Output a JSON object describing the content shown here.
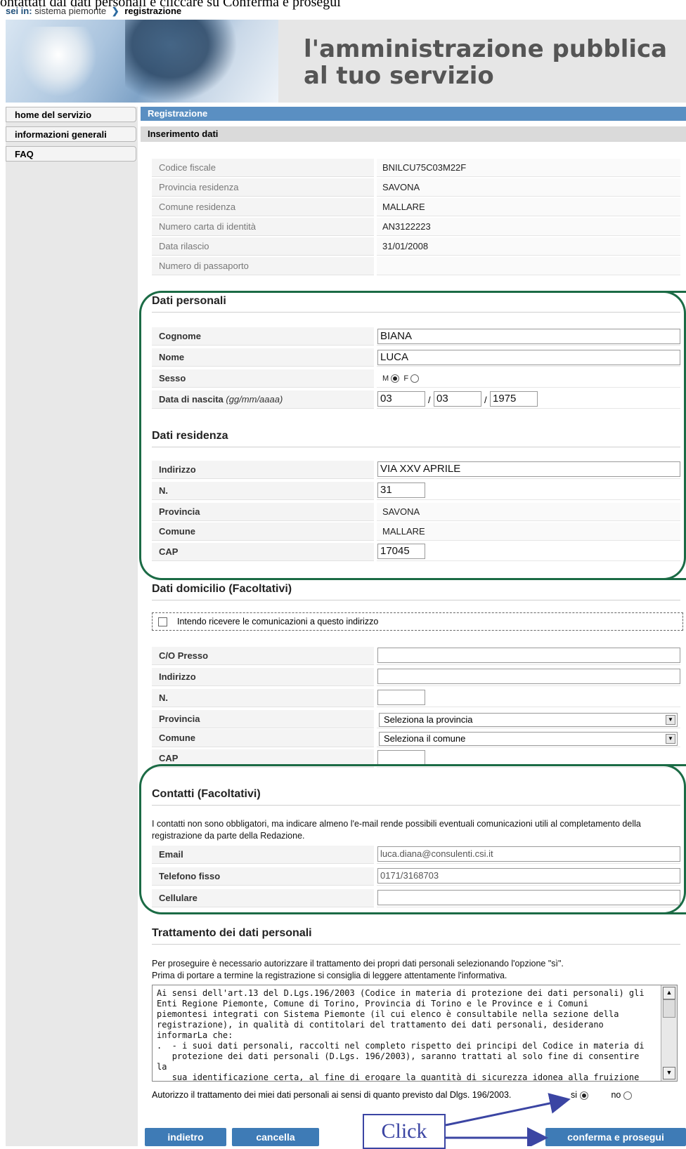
{
  "caption_text": "ontattati dai dati personali e cliccare su Conferma e prosegui",
  "breadcrumb": {
    "label": "sei in:",
    "root": "sistema piemonte",
    "current": "registrazione"
  },
  "banner": {
    "line1": "l'amministrazione pubblica",
    "line2": "al tuo servizio"
  },
  "sidebar": {
    "items": [
      "home del servizio",
      "informazioni generali",
      "FAQ"
    ]
  },
  "header": {
    "registrazione": "Registrazione",
    "inserimento": "Inserimento dati"
  },
  "readonly": [
    {
      "label": "Codice fiscale",
      "value": "BNILCU75C03M22F"
    },
    {
      "label": "Provincia residenza",
      "value": "SAVONA"
    },
    {
      "label": "Comune residenza",
      "value": "MALLARE"
    },
    {
      "label": "Numero carta di identità",
      "value": "AN3122223"
    },
    {
      "label": "Data rilascio",
      "value": "31/01/2008"
    },
    {
      "label": "Numero di passaporto",
      "value": ""
    }
  ],
  "dati_personali": {
    "title": "Dati personali",
    "cognome_label": "Cognome",
    "cognome": "BIANA",
    "nome_label": "Nome",
    "nome": "LUCA",
    "sesso_label": "Sesso",
    "sesso_m": "M",
    "sesso_f": "F",
    "nascita_label": "Data di nascita",
    "nascita_hint": "(gg/mm/aaaa)",
    "gg": "03",
    "mm": "03",
    "aaaa": "1975"
  },
  "dati_residenza": {
    "title": "Dati residenza",
    "indirizzo_label": "Indirizzo",
    "indirizzo": "VIA XXV APRILE",
    "n_label": "N.",
    "n": "31",
    "provincia_label": "Provincia",
    "provincia": "SAVONA",
    "comune_label": "Comune",
    "comune": "MALLARE",
    "cap_label": "CAP",
    "cap": "17045"
  },
  "dati_domicilio": {
    "title": "Dati domicilio (Facoltativi)",
    "checkbox_label": "Intendo ricevere le comunicazioni a questo indirizzo",
    "presso_label": "C/O Presso",
    "indirizzo_label": "Indirizzo",
    "n_label": "N.",
    "provincia_label": "Provincia",
    "provincia_select": "Seleziona la provincia",
    "comune_label": "Comune",
    "comune_select": "Seleziona il comune",
    "cap_label": "CAP"
  },
  "contatti": {
    "title": "Contatti (Facoltativi)",
    "note": "I contatti non sono obbligatori, ma indicare almeno l'e-mail rende possibili eventuali comunicazioni utili al completamento della registrazione da parte della Redazione.",
    "email_label": "Email",
    "email": "luca.diana@consulenti.csi.it",
    "tel_label": "Telefono fisso",
    "tel": "0171/3168703",
    "cell_label": "Cellulare",
    "cell": ""
  },
  "trattamento": {
    "title": "Trattamento dei dati personali",
    "p1": "Per proseguire è necessario autorizzare il trattamento dei propri dati personali selezionando l'opzione \"sì\".",
    "p2": "Prima di portare a termine la registrazione si consiglia di leggere attentamente l'informativa.",
    "informativa": "Ai sensi dell'art.13 del D.Lgs.196/2003 (Codice in materia di protezione dei dati personali) gli\nEnti Regione Piemonte, Comune di Torino, Provincia di Torino e le Province e i Comuni\npiemontesi integrati con Sistema Piemonte (il cui elenco è consultabile nella sezione della\nregistrazione), in qualità di contitolari del trattamento dei dati personali, desiderano\ninformarLa che:\n.  - i suoi dati personali, raccolti nel completo rispetto dei principi del Codice in materia di\n   protezione dei dati personali (D.Lgs. 196/2003), saranno trattati al solo fine di consentire la\n   sua identificazione certa, al fine di erogare la quantità di sicurezza idonea alla fruizione dei",
    "autorizzo": "Autorizzo il trattamento dei miei dati personali ai sensi di quanto previsto dal Dlgs. 196/2003.",
    "si": "si",
    "no": "no"
  },
  "buttons": {
    "indietro": "indietro",
    "cancella": "cancella",
    "conferma": "conferma e prosegui"
  },
  "annotation": {
    "click": "Click"
  }
}
